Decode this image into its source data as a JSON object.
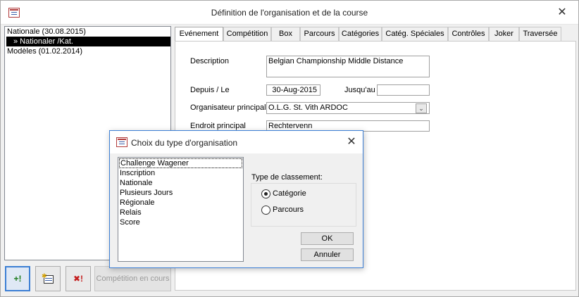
{
  "window": {
    "title": "Définition de l'organisation et de la course"
  },
  "left_list": {
    "items": [
      {
        "label": "Nationale (30.08.2015)",
        "selected": false
      },
      {
        "label": "» Nationaler /Kat.",
        "selected": true
      },
      {
        "label": "Modèles (01.02.2014)",
        "selected": false
      }
    ]
  },
  "bottom_buttons": {
    "add_symbol": "+!",
    "delete_symbol": "✖!",
    "current_competition_label": "Compétition en cours"
  },
  "tabs": [
    {
      "label": "Evénement",
      "active": true
    },
    {
      "label": "Compétition",
      "active": false
    },
    {
      "label": "Box",
      "active": false
    },
    {
      "label": "Parcours",
      "active": false
    },
    {
      "label": "Catégories",
      "active": false
    },
    {
      "label": "Catég. Spéciales",
      "active": false
    },
    {
      "label": "Contrôles",
      "active": false
    },
    {
      "label": "Joker",
      "active": false
    },
    {
      "label": "Traversée",
      "active": false
    }
  ],
  "form": {
    "description_label": "Description",
    "description_value": "Belgian Championship Middle Distance",
    "from_label": "Depuis / Le",
    "from_value": "30-Aug-2015",
    "until_label": "Jusqu'au",
    "until_value": "",
    "organizer_label": "Organisateur principal",
    "organizer_value": "O.L.G. St. Vith ARDOC",
    "location_label": "Endroit principal",
    "location_value": "Rechtervenn"
  },
  "dialog": {
    "title": "Choix du type d'organisation",
    "types": [
      "Challenge Wagener",
      "Inscription",
      "Nationale",
      "Plusieurs Jours",
      "Régionale",
      "Relais",
      "Score"
    ],
    "ranking_label": "Type de classement:",
    "ranking_options": [
      {
        "label": "Catégorie",
        "selected": true
      },
      {
        "label": "Parcours",
        "selected": false
      }
    ],
    "ok_label": "OK",
    "cancel_label": "Annuler"
  }
}
